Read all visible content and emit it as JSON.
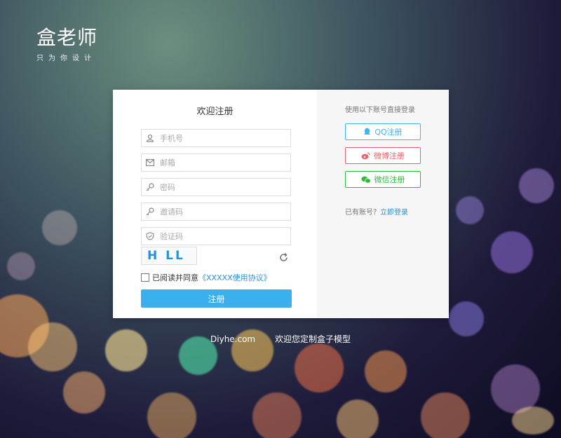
{
  "logo": {
    "main": "盒老师",
    "sub": "只为你设计"
  },
  "register": {
    "title": "欢迎注册",
    "phone_placeholder": "手机号",
    "email_placeholder": "邮箱",
    "password_placeholder": "密码",
    "invite_placeholder": "邀请码",
    "captcha_placeholder": "验证码",
    "captcha_text": "H LL",
    "agree_prefix": "已阅读并同意",
    "agreement_link": "《XXXXX使用协议》",
    "submit_label": "注册"
  },
  "social": {
    "title": "使用以下账号直接登录",
    "qq_label": "QQ注册",
    "weibo_label": "微博注册",
    "wechat_label": "微信注册",
    "have_account": "已有账号？",
    "login_link": "立即登录"
  },
  "footer": {
    "site": "Diyhe.com",
    "slogan": "欢迎您定制盒子模型"
  },
  "colors": {
    "accent": "#3ab0ee",
    "qq": "#3cb8ea",
    "weibo": "#e8636b",
    "wechat": "#2dbb3c"
  },
  "icons": [
    "user-icon",
    "mail-icon",
    "key-icon",
    "shield-icon",
    "refresh-icon",
    "qq-icon",
    "weibo-icon",
    "wechat-icon"
  ]
}
